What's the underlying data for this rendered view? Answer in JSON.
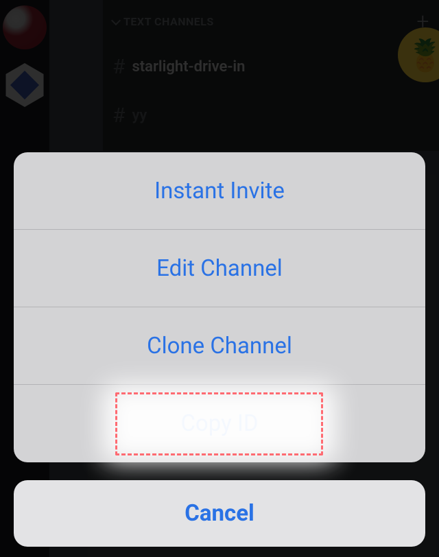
{
  "servers": {
    "list": [
      {
        "name": "robot-avatar"
      },
      {
        "name": "hexagon-logo"
      }
    ]
  },
  "channels": {
    "category_label": "TEXT CHANNELS",
    "items": [
      {
        "name": "starlight-drive-in",
        "active": true,
        "restricted": false
      },
      {
        "name": "yy",
        "active": false,
        "restricted": true
      }
    ]
  },
  "context_menu": {
    "items": [
      {
        "label": "Instant Invite"
      },
      {
        "label": "Edit Channel"
      },
      {
        "label": "Clone Channel"
      },
      {
        "label": "Copy ID"
      }
    ],
    "cancel_label": "Cancel"
  },
  "annotation": {
    "highlighted_item": "Copy ID"
  }
}
